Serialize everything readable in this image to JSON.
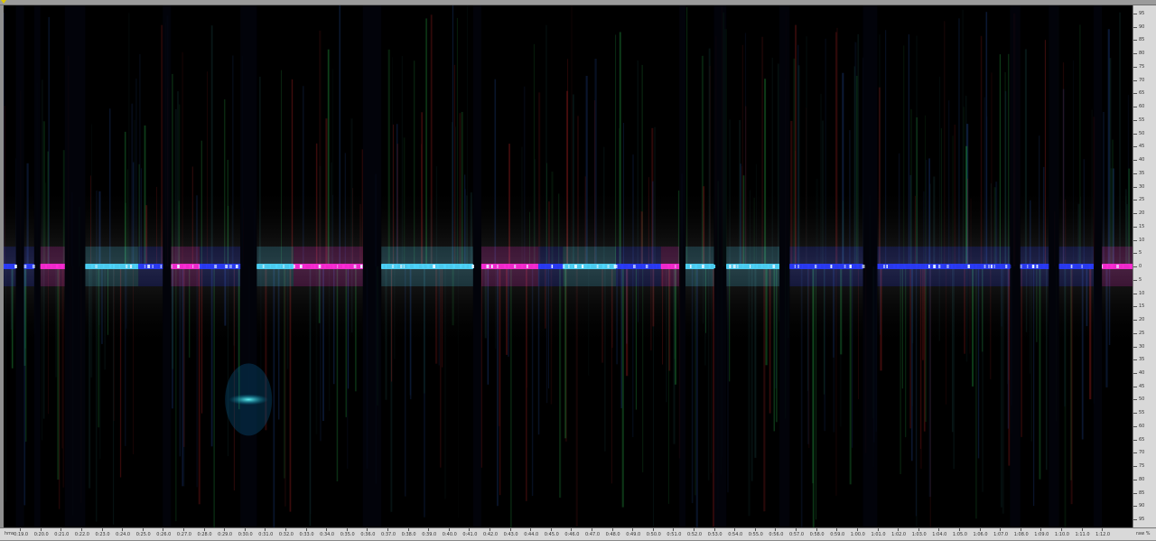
{
  "x_unit_label": "hms",
  "y_unit_label": "raw %",
  "colors": {
    "background": "#000000",
    "ruler": "#d9d9d9",
    "center_cyan": "#4fd8ff",
    "center_blue": "#2a3cff",
    "center_magenta": "#ff2ad8",
    "noise_green": "#1f8f3a",
    "noise_red": "#8a1a1a",
    "corner_marker": "#e0c800"
  },
  "time_ticks": [
    "0:19.0",
    "0:20.0",
    "0:21.0",
    "0:22.0",
    "0:23.0",
    "0:24.0",
    "0:25.0",
    "0:26.0",
    "0:27.0",
    "0:28.0",
    "0:29.0",
    "0:30.0",
    "0:31.0",
    "0:32.0",
    "0:33.0",
    "0:34.0",
    "0:35.0",
    "0:36.0",
    "0:37.0",
    "0:38.0",
    "0:39.0",
    "0:40.0",
    "0:41.0",
    "0:42.0",
    "0:43.0",
    "0:44.0",
    "0:45.0",
    "0:46.0",
    "0:47.0",
    "0:48.0",
    "0:49.0",
    "0:50.0",
    "0:51.0",
    "0:52.0",
    "0:53.0",
    "0:54.0",
    "0:55.0",
    "0:56.0",
    "0:57.0",
    "0:58.0",
    "0:59.0",
    "1:00.0",
    "1:01.0",
    "1:02.0",
    "1:03.0",
    "1:04.0",
    "1:05.0",
    "1:06.0",
    "1:07.0",
    "1:08.0",
    "1:09.0",
    "1:10.0",
    "1:11.0",
    "1:12.0"
  ],
  "percent_ticks": [
    "95",
    "90",
    "85",
    "80",
    "75",
    "70",
    "65",
    "60",
    "55",
    "50",
    "45",
    "40",
    "35",
    "30",
    "25",
    "20",
    "15",
    "10",
    "5",
    "0",
    "5",
    "10",
    "15",
    "20",
    "25",
    "30",
    "35",
    "40",
    "45",
    "50",
    "55",
    "60",
    "65",
    "70",
    "75",
    "80",
    "85",
    "90",
    "95"
  ],
  "chart_data": {
    "type": "heatmap",
    "center_value": 0,
    "x_range": [
      "0:18.2",
      "1:13.5"
    ],
    "y_range": [
      -98,
      98
    ],
    "silent_gaps_seconds": [
      [
        18.8,
        19.2
      ],
      [
        19.7,
        20.0
      ],
      [
        21.2,
        22.2
      ],
      [
        26.0,
        26.4
      ],
      [
        29.8,
        30.6
      ],
      [
        35.8,
        36.7
      ],
      [
        41.2,
        41.6
      ],
      [
        51.3,
        51.6
      ],
      [
        53.0,
        53.6
      ],
      [
        56.2,
        56.7
      ],
      [
        60.3,
        61.0
      ],
      [
        67.5,
        68.0
      ],
      [
        69.4,
        69.9
      ],
      [
        71.6,
        72.0
      ]
    ],
    "bright_segments_seconds": [
      [
        18.2,
        18.8,
        "blue"
      ],
      [
        19.2,
        19.7,
        "blue"
      ],
      [
        20.0,
        21.2,
        "magenta"
      ],
      [
        22.2,
        24.8,
        "cyan"
      ],
      [
        24.8,
        26.0,
        "blue"
      ],
      [
        26.4,
        27.8,
        "magenta"
      ],
      [
        27.8,
        29.8,
        "blue"
      ],
      [
        30.6,
        32.4,
        "cyan"
      ],
      [
        32.4,
        35.8,
        "magenta"
      ],
      [
        36.7,
        41.2,
        "cyan"
      ],
      [
        41.6,
        44.4,
        "magenta"
      ],
      [
        44.4,
        45.6,
        "blue"
      ],
      [
        45.6,
        48.2,
        "cyan"
      ],
      [
        48.2,
        50.4,
        "blue"
      ],
      [
        50.4,
        51.3,
        "magenta"
      ],
      [
        51.6,
        53.0,
        "cyan"
      ],
      [
        53.6,
        56.2,
        "cyan"
      ],
      [
        56.7,
        60.3,
        "blue"
      ],
      [
        61.0,
        64.6,
        "blue"
      ],
      [
        64.6,
        67.5,
        "blue"
      ],
      [
        68.0,
        69.4,
        "blue"
      ],
      [
        69.9,
        71.6,
        "blue"
      ],
      [
        72.0,
        73.5,
        "magenta"
      ]
    ],
    "hotspots": [
      {
        "time_seconds": 30.2,
        "percent": -50,
        "color": "cyan"
      }
    ]
  }
}
